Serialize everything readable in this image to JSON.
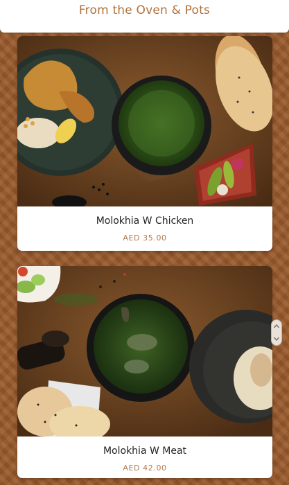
{
  "header": {
    "title": "From the Oven & Pots"
  },
  "menu_items": [
    {
      "name": "Molokhia W Chicken",
      "price": "AED 35.00",
      "photo": "molokhia-chicken-photo"
    },
    {
      "name": "Molokhia W Meat",
      "price": "AED 42.00",
      "photo": "molokhia-meat-photo"
    }
  ],
  "icons": {
    "scroll_handle": "scroll-handle-icon"
  },
  "colors": {
    "accent": "#b0703a",
    "price": "#b07a4e",
    "background": "#9b5b2d"
  }
}
